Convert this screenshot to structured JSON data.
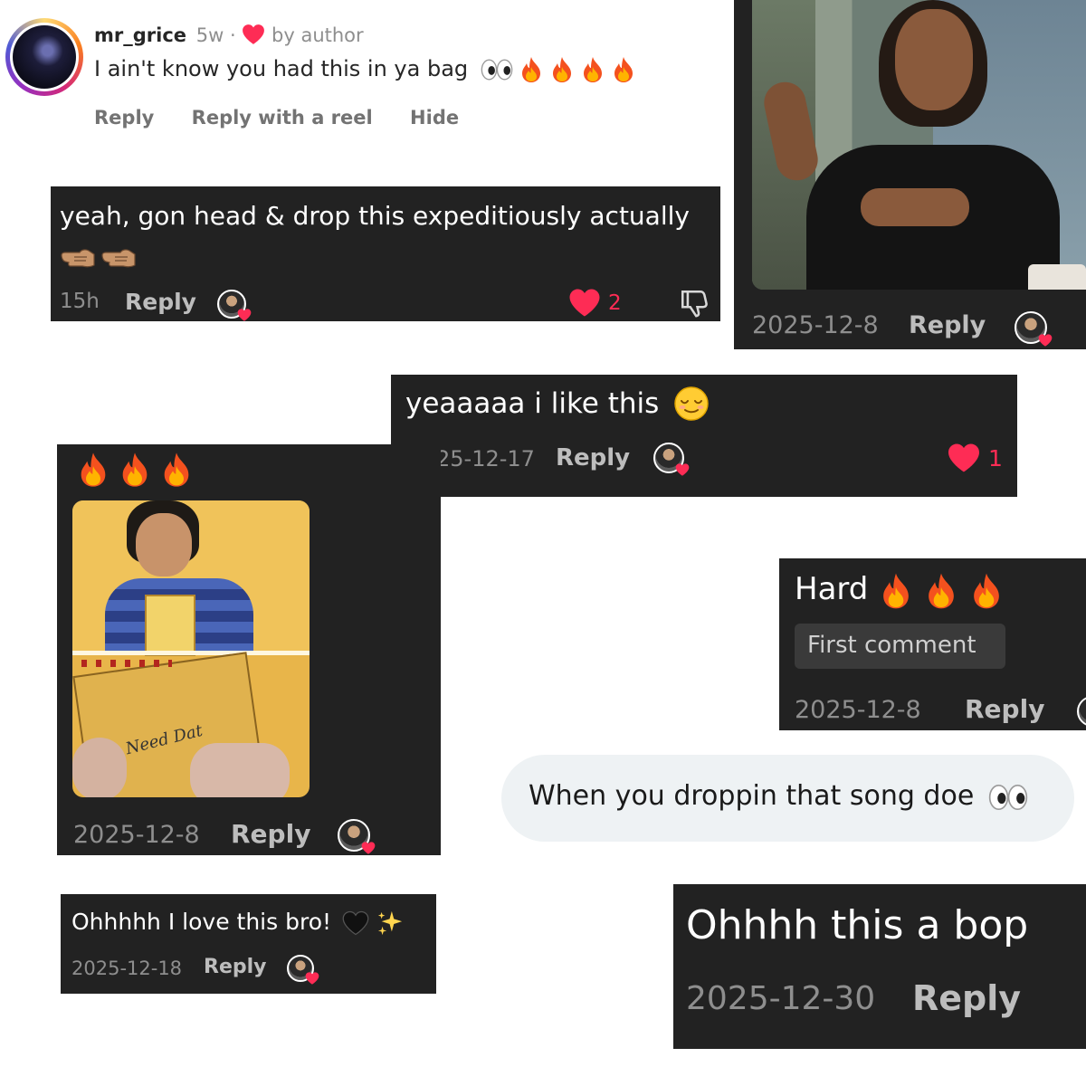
{
  "colors": {
    "card_bg": "#222222",
    "heart_red": "#fe2c55",
    "meta_gray": "#8e8e8e",
    "ig_name": "#262626",
    "ig_action": "#737373",
    "bubble_bg": "#eef2f4"
  },
  "ig_comment": {
    "username": "mr_grice",
    "time": "5w",
    "separator": "·",
    "liked_by": "by author",
    "text": "I ain't know you had this in ya bag",
    "emojis": [
      "eyes-emoji",
      "fire-emoji",
      "fire-emoji",
      "fire-emoji",
      "fire-emoji"
    ],
    "actions": [
      "Reply",
      "Reply with a reel",
      "Hide"
    ]
  },
  "comment_expeditiously": {
    "text": "yeah, gon head & drop this expeditiously actually",
    "emojis": [
      "backhand-index-left-emoji",
      "backhand-index-left-emoji"
    ],
    "time": "15h",
    "reply": "Reply",
    "likes": "2"
  },
  "comment_meme": {
    "date": "2025-12-8",
    "reply": "Reply"
  },
  "comment_like_this": {
    "text": "yeaaaaa i like this",
    "date": "25-12-17",
    "reply": "Reply",
    "likes": "1"
  },
  "comment_notepad": {
    "notepad_text": "Need Dat",
    "date": "2025-12-8",
    "reply": "Reply"
  },
  "comment_hard": {
    "text": "Hard",
    "badge": "First comment",
    "date": "2025-12-8",
    "reply": "Reply"
  },
  "bubble": {
    "text": "When you droppin that song doe"
  },
  "comment_love": {
    "text": "Ohhhhh I love this bro!",
    "date": "2025-12-18",
    "reply": "Reply"
  },
  "comment_bop": {
    "text": "Ohhhh this a bop",
    "date": "2025-12-30",
    "reply": "Reply"
  }
}
